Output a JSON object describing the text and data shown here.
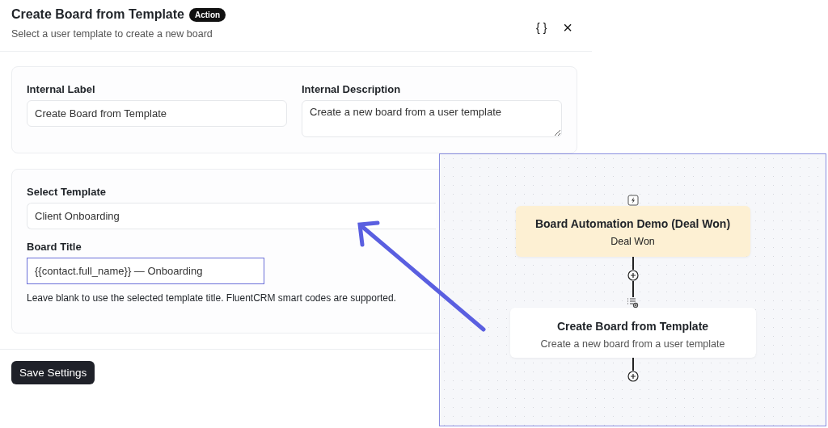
{
  "header": {
    "title": "Create Board from Template",
    "badge": "Action",
    "subtitle": "Select a user template to create a new board",
    "code_button": "{ }",
    "close_button": "×"
  },
  "general": {
    "label_field": {
      "label": "Internal Label",
      "value": "Create Board from Template"
    },
    "description_field": {
      "label": "Internal Description",
      "value": "Create a new board from a user template"
    }
  },
  "settings": {
    "template_field": {
      "label": "Select Template",
      "value": "Client Onboarding"
    },
    "title_field": {
      "label": "Board Title",
      "value": "{{contact.full_name}} — Onboarding",
      "highlighted": true,
      "help": "Leave blank to use the selected template title. FluentCRM smart codes are supported."
    }
  },
  "save_button": "Save Settings",
  "flow": {
    "nodes": [
      {
        "kind": "trigger",
        "title": "Board Automation Demo (Deal Won)",
        "subtitle": "Deal Won"
      },
      {
        "kind": "action",
        "title": "Create Board from Template",
        "subtitle": "Create a new board from a user template"
      }
    ]
  }
}
